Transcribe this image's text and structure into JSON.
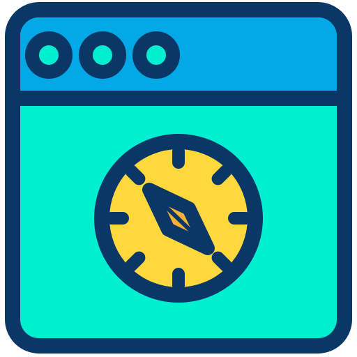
{
  "icon": {
    "name": "browser-compass-icon",
    "parts": [
      "window-frame-icon",
      "title-bar",
      "window-dot-icon",
      "compass-icon",
      "compass-needle-icon"
    ]
  },
  "colors": {
    "outline": "#0b3766",
    "title_bar": "#03a9e6",
    "window_body": "#00efd1",
    "dot_fill": "#00efd1",
    "compass_face": "#fed83c",
    "needle_fill": "#f7b036"
  }
}
